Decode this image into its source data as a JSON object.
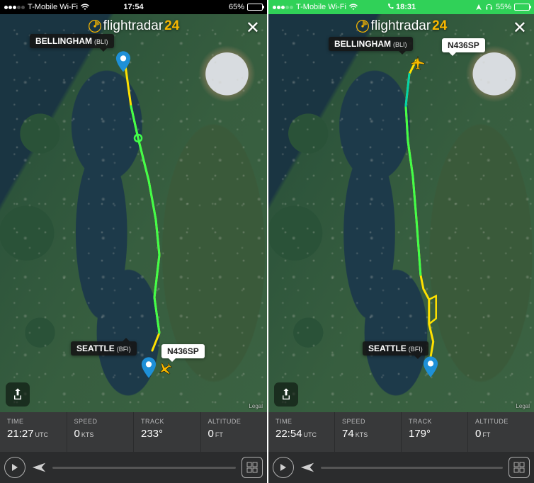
{
  "app": {
    "logo_text": "flightradar",
    "logo_suffix": "24",
    "legal": "Legal"
  },
  "panels": [
    {
      "status": {
        "carrier": "T-Mobile Wi-Fi",
        "time": "17:54",
        "battery_pct": "65%",
        "style": "dark",
        "has_nav": false,
        "has_headset": false,
        "battery_fill": 65
      },
      "origin": {
        "name": "BELLINGHAM",
        "code": "(BLI)"
      },
      "dest": {
        "name": "SEATTLE",
        "code": "(BFI)"
      },
      "callsign": "N436SP",
      "data": {
        "time_label": "TIME",
        "time_value": "21:27",
        "time_unit": "UTC",
        "speed_label": "SPEED",
        "speed_value": "0",
        "speed_unit": "KTS",
        "track_label": "TRACK",
        "track_value": "233°",
        "alt_label": "ALTITUDE",
        "alt_value": "0",
        "alt_unit": "FT"
      }
    },
    {
      "status": {
        "carrier": "T-Mobile Wi-Fi",
        "time": "18:31",
        "battery_pct": "55%",
        "style": "green",
        "has_nav": true,
        "has_headset": true,
        "battery_fill": 55
      },
      "origin": {
        "name": "BELLINGHAM",
        "code": "(BLI)"
      },
      "dest": {
        "name": "SEATTLE",
        "code": "(BFI)"
      },
      "callsign": "N436SP",
      "data": {
        "time_label": "TIME",
        "time_value": "22:54",
        "time_unit": "UTC",
        "speed_label": "SPEED",
        "speed_value": "74",
        "speed_unit": "KTS",
        "track_label": "TRACK",
        "track_value": "179°",
        "alt_label": "ALTITUDE",
        "alt_value": "0",
        "alt_unit": "FT"
      }
    }
  ]
}
